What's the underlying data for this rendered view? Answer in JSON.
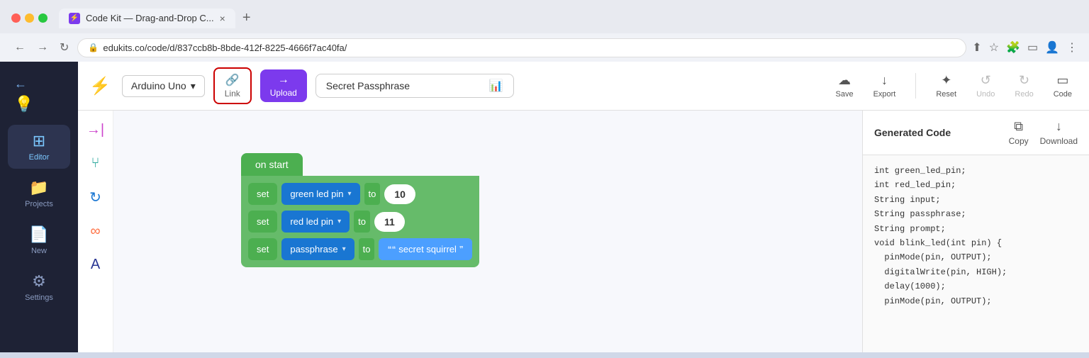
{
  "browser": {
    "tab_label": "Code Kit — Drag-and-Drop C...",
    "url": "edukits.co/code/d/837ccb8b-8bde-412f-8225-4666f7ac40fa/",
    "tab_close": "×",
    "tab_new": "+"
  },
  "toolbar": {
    "board_label": "Arduino Uno",
    "link_label": "Link",
    "upload_label": "Upload",
    "passphrase_label": "Secret Passphrase",
    "save_label": "Save",
    "export_label": "Export",
    "reset_label": "Reset",
    "undo_label": "Undo",
    "redo_label": "Redo",
    "code_label": "Code"
  },
  "sidebar": {
    "back_icon": "←",
    "items": [
      {
        "label": "Editor",
        "icon": "⊞",
        "active": true
      },
      {
        "label": "Projects",
        "icon": "📁",
        "active": false
      },
      {
        "label": "New",
        "icon": "📄+",
        "active": false
      },
      {
        "label": "Settings",
        "icon": "⚙",
        "active": false
      }
    ]
  },
  "canvas": {
    "on_start_label": "on start",
    "blocks": [
      {
        "set": "set",
        "var": "green led pin",
        "to": "to",
        "value": "10"
      },
      {
        "set": "set",
        "var": "red led pin",
        "to": "to",
        "value": "11"
      },
      {
        "set": "set",
        "var": "passphrase",
        "to": "to",
        "string": "secret squirrel"
      }
    ]
  },
  "code_panel": {
    "title": "Generated Code",
    "copy_label": "Copy",
    "download_label": "Download",
    "code_lines": [
      "int green_led_pin;",
      "int red_led_pin;",
      "String input;",
      "String passphrase;",
      "String prompt;",
      "void blink_led(int pin) {",
      "  pinMode(pin, OUTPUT);",
      "  digitalWrite(pin, HIGH);",
      "  delay(1000);",
      "  pinMode(pin, OUTPUT);"
    ]
  }
}
